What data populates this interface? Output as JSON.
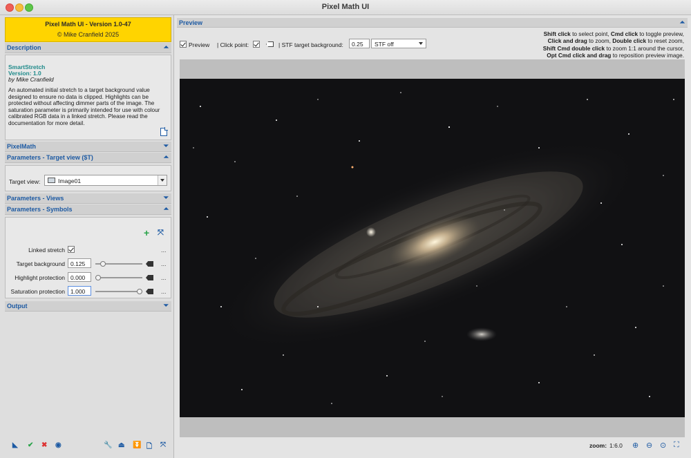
{
  "window": {
    "title": "Pixel Math UI"
  },
  "left": {
    "banner": {
      "line1": "Pixel Math UI - Version 1.0-47",
      "line2": "© Mike Cranfield 2025"
    },
    "sections": {
      "description": "Description",
      "pixelmath": "PixelMath",
      "target_view": "Parameters - Target view ($T)",
      "views": "Parameters - Views",
      "symbols": "Parameters - Symbols",
      "output": "Output"
    },
    "description": {
      "title": "SmartStretch",
      "version": "Version: 1.0",
      "author": "by Mike Cranfield",
      "body": "An automated initial stretch to a target background value designed to ensure no data is clipped. Highlights can be protected without affecting dimmer parts of the image. The saturation parameter is primarily intended for use with colour calibrated RGB data in a linked stretch. Please read the documentation for more detail."
    },
    "target_view": {
      "label": "Target view:",
      "value": "Image01"
    },
    "symbols": {
      "linked_stretch": {
        "label": "Linked stretch",
        "checked": true
      },
      "params": [
        {
          "label": "Target background",
          "value": "0.125",
          "fraction": 0.12
        },
        {
          "label": "Highlight protection",
          "value": "0.000",
          "fraction": 0.0
        },
        {
          "label": "Saturation protection",
          "value": "1.000",
          "fraction": 1.0
        }
      ],
      "more": "..."
    }
  },
  "preview": {
    "section": "Preview",
    "preview_label": "Preview",
    "click_point_label": "| Click point:",
    "stf_label": "| STF target background:",
    "stf_value": "0.25",
    "stf_mode": "STF off",
    "help": [
      {
        "b": "Shift click",
        "t": " to select point, ",
        "b2": "Cmd click",
        "t2": " to toggle preview,"
      },
      {
        "b": "Click and drag",
        "t": " to zoom, ",
        "b2": "Double click",
        "t2": " to reset zoom,"
      },
      {
        "b": "Shift Cmd double click",
        "t": " to zoom 1:1 around the cursor,",
        "b2": "",
        "t2": ""
      },
      {
        "b": "Opt Cmd click and drag",
        "t": " to reposition preview image.",
        "b2": "",
        "t2": ""
      }
    ],
    "zoom_label": "zoom:",
    "zoom_value": "1:6.0"
  },
  "colors": {
    "accent": "#1d5aa3",
    "banner": "#ffd400",
    "teal": "#1f8a8a"
  }
}
